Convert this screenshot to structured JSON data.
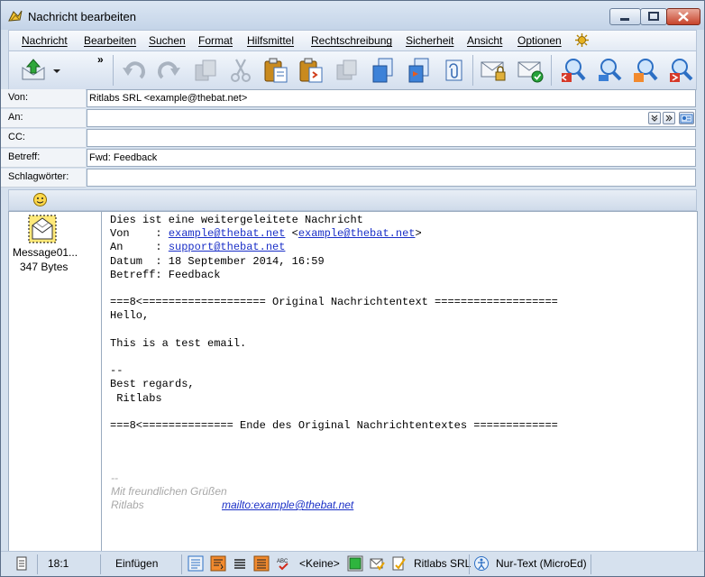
{
  "window": {
    "title": "Nachricht bearbeiten"
  },
  "menu": [
    "Nachricht",
    "Bearbeiten",
    "Suchen",
    "Format",
    "Hilfsmittel",
    "Rechtschreibung",
    "Sicherheit",
    "Ansicht",
    "Optionen"
  ],
  "headers": {
    "from_label": "Von:",
    "from_value": "Ritlabs SRL <example@thebat.net>",
    "to_label": "An:",
    "to_value": "",
    "cc_label": "CC:",
    "cc_value": "",
    "subject_label": "Betreff:",
    "subject_value": "Fwd: Feedback",
    "keywords_label": "Schlagwörter:",
    "keywords_value": ""
  },
  "attachment": {
    "name": "Message01...",
    "size": "347 Bytes"
  },
  "body": {
    "intro": "Dies ist eine weitergeleitete Nachricht",
    "from_prefix": "Von    : ",
    "from_email": "example@thebat.net",
    "from_lt": " <",
    "from_email2": "example@thebat.net",
    "from_gt": ">",
    "to_prefix": "An     : ",
    "to_email": "support@thebat.net",
    "date_line": "Datum  : 18 September 2014, 16:59",
    "subject_line": "Betreff: Feedback",
    "orig_start": "===8<=================== Original Nachrichtentext ===================",
    "hello": "Hello,",
    "test": "This is a test email.",
    "dashes": "--",
    "regards": "Best regards,",
    "company": " Ritlabs",
    "orig_end": "===8<============== Ende des Original Nachrichtentextes ============="
  },
  "signature": {
    "dashes": "--",
    "greeting": "Mit freundlichen Grüßen",
    "name": "Ritlabs",
    "link": "mailto:example@thebat.net"
  },
  "status": {
    "position": "18:1",
    "mode": "Einfügen",
    "template": "<Keine>",
    "account": "Ritlabs SRL",
    "editor": "Nur-Text (MicroEd)"
  },
  "colors": {
    "link": "#1a2fc7",
    "signature": "#a8a8a8",
    "accent_orange": "#f28a2e"
  }
}
